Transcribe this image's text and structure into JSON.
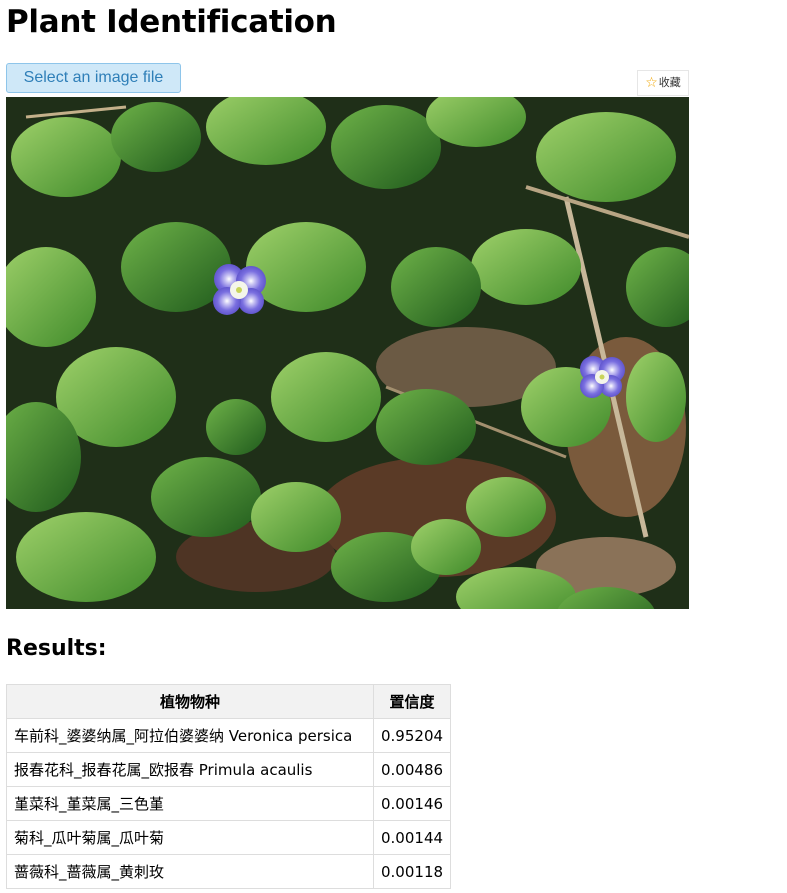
{
  "page": {
    "title": "Plant Identification"
  },
  "upload": {
    "button_label": "Select an image file"
  },
  "favorite": {
    "icon": "star-outline-icon",
    "label": "收藏",
    "icon_color": "#f0a500"
  },
  "photo": {
    "alt": "Veronica persica flowers among leaves"
  },
  "results": {
    "heading": "Results:",
    "columns": [
      "植物物种",
      "置信度"
    ],
    "rows": [
      {
        "species": "车前科_婆婆纳属_阿拉伯婆婆纳 Veronica persica",
        "confidence": "0.95204"
      },
      {
        "species": "报春花科_报春花属_欧报春 Primula acaulis",
        "confidence": "0.00486"
      },
      {
        "species": "堇菜科_堇菜属_三色堇",
        "confidence": "0.00146"
      },
      {
        "species": "菊科_瓜叶菊属_瓜叶菊",
        "confidence": "0.00144"
      },
      {
        "species": "蔷薇科_蔷薇属_黄刺玫",
        "confidence": "0.00118"
      }
    ]
  },
  "colors": {
    "button_bg": "#cfe8f8",
    "button_border": "#8ec5ea",
    "button_text": "#2f7fb8",
    "table_header_bg": "#f2f2f2",
    "table_border": "#dddddd"
  }
}
